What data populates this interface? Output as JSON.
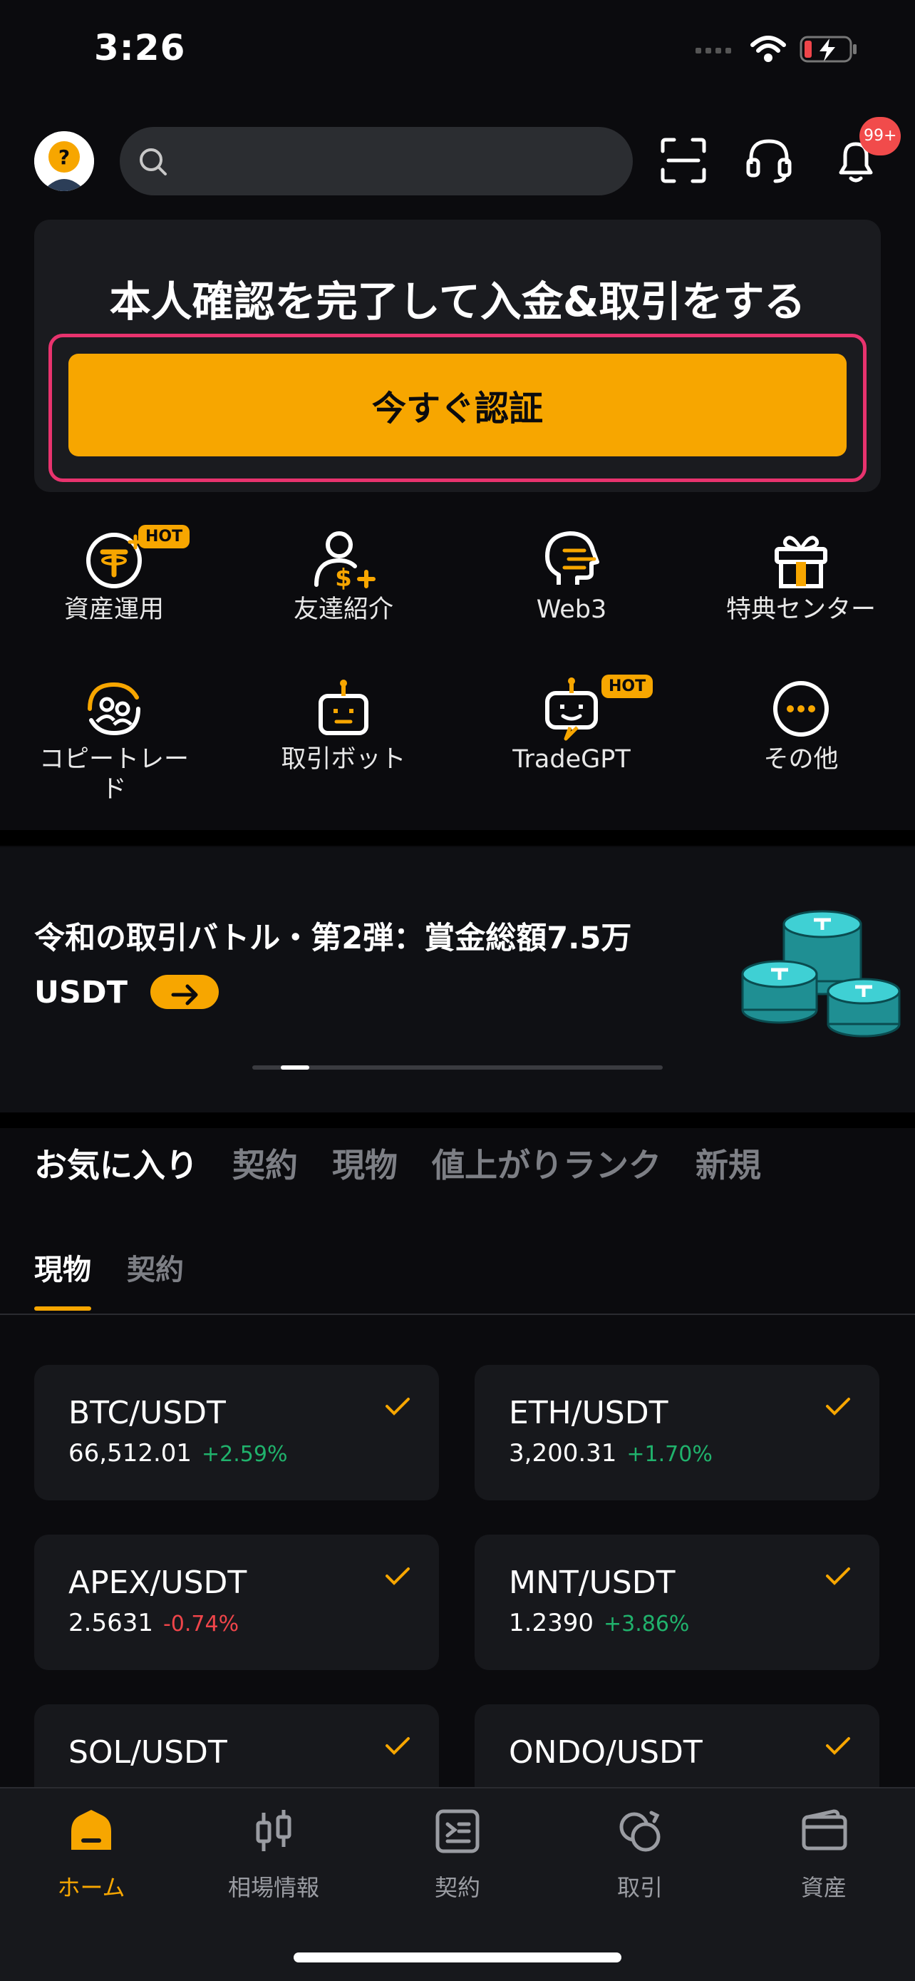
{
  "status_bar": {
    "time": "3:26"
  },
  "header": {
    "search_placeholder": "",
    "notification_badge": "99+"
  },
  "verify_card": {
    "title": "本人確認を完了して入金&取引をする",
    "button_label": "今すぐ認証"
  },
  "shortcuts": [
    {
      "label": "資産運用",
      "icon": "tether-coin-icon",
      "hot": "HOT"
    },
    {
      "label": "友達紹介",
      "icon": "referral-icon"
    },
    {
      "label": "Web3",
      "icon": "web3-head-icon"
    },
    {
      "label": "特典センター",
      "icon": "gift-icon"
    },
    {
      "label": "コピートレード",
      "icon": "copy-trade-icon"
    },
    {
      "label": "取引ボット",
      "icon": "bot-icon"
    },
    {
      "label": "TradeGPT",
      "icon": "tradegpt-icon",
      "hot": "HOT"
    },
    {
      "label": "その他",
      "icon": "more-icon"
    }
  ],
  "banner": {
    "line1": "令和の取引バトル・第2弾：賞金総額7.5万",
    "line2": "USDT"
  },
  "market_tabs": [
    "お気に入り",
    "契約",
    "現物",
    "値上がりランク",
    "新規"
  ],
  "market_tab_active": 0,
  "sub_tabs": [
    "現物",
    "契約"
  ],
  "sub_tab_active": 0,
  "pairs": [
    {
      "name": "BTC/USDT",
      "price": "66,512.01",
      "change": "+2.59%",
      "direction": "up"
    },
    {
      "name": "ETH/USDT",
      "price": "3,200.31",
      "change": "+1.70%",
      "direction": "up"
    },
    {
      "name": "APEX/USDT",
      "price": "2.5631",
      "change": "-0.74%",
      "direction": "down"
    },
    {
      "name": "MNT/USDT",
      "price": "1.2390",
      "change": "+3.86%",
      "direction": "up"
    },
    {
      "name": "SOL/USDT",
      "price": "",
      "change": "",
      "direction": "up"
    },
    {
      "name": "ONDO/USDT",
      "price": "",
      "change": "",
      "direction": "up"
    }
  ],
  "bottom_nav": [
    {
      "label": "ホーム",
      "icon": "home-icon",
      "active": true
    },
    {
      "label": "相場情報",
      "icon": "candlestick-icon"
    },
    {
      "label": "契約",
      "icon": "contract-icon"
    },
    {
      "label": "取引",
      "icon": "trade-icon"
    },
    {
      "label": "資産",
      "icon": "wallet-icon"
    }
  ],
  "colors": {
    "accent": "#f7a600",
    "up": "#20b26c",
    "down": "#ef454a",
    "highlight_outline": "#e8336e",
    "badge": "#f14b4b"
  }
}
